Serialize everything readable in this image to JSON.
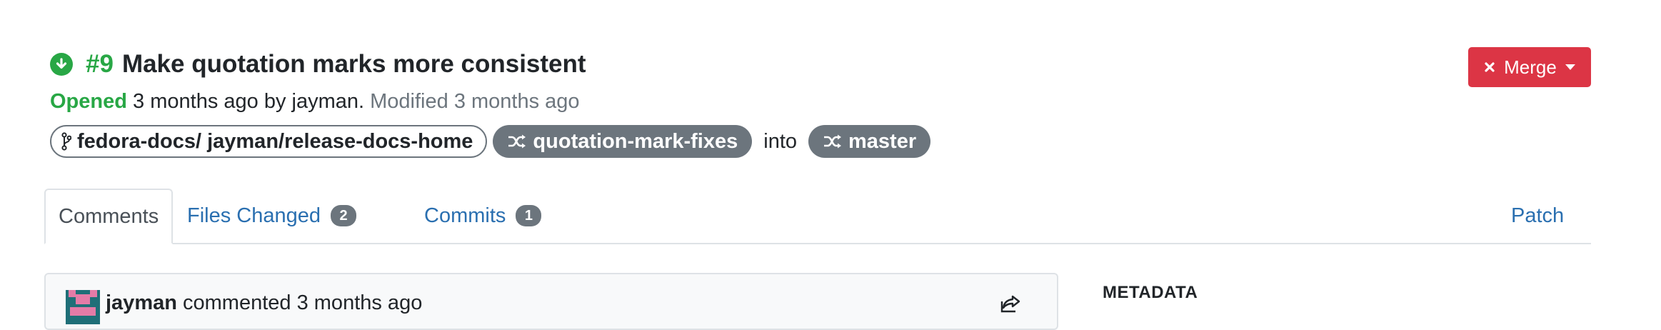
{
  "pr": {
    "number": "#9",
    "title": "Make quotation marks more consistent",
    "status": "Opened",
    "time_ago": "3 months ago",
    "by_text": "by jayman.",
    "modified_label": "Modified",
    "modified_time": "3 months ago",
    "source_repo": "fedora-docs/ jayman/release-docs-home",
    "source_branch": "quotation-mark-fixes",
    "into_label": "into",
    "target_branch": "master",
    "status_color": "#28a745"
  },
  "actions": {
    "merge_label": "Merge",
    "merge_color": "#dc3545"
  },
  "tabs": {
    "comments": "Comments",
    "files_changed": "Files Changed",
    "files_changed_count": "2",
    "commits": "Commits",
    "commits_count": "1",
    "patch": "Patch"
  },
  "comment": {
    "user": "jayman",
    "action": "commented",
    "time_ago": "3 months ago"
  },
  "sidebar": {
    "metadata_heading": "METADATA"
  },
  "icons": {
    "status": "arrow-circle-down-icon",
    "repo": "code-fork-icon",
    "branch": "random-icon",
    "merge": "times-icon",
    "share": "share-icon"
  }
}
